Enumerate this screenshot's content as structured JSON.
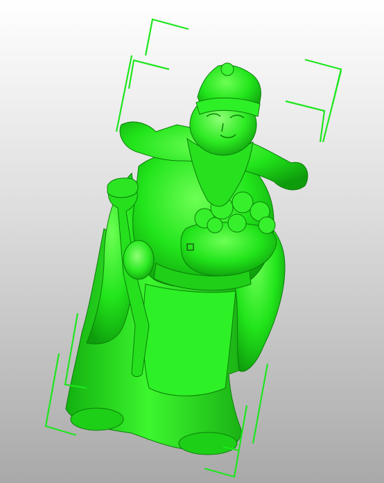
{
  "viewport": {
    "background_top": "#ffffff",
    "background_bottom": "#a9a9a9"
  },
  "model": {
    "name": "statue-model",
    "color": "#22e51b",
    "shade_color": "#0c8f0a",
    "highlight_color": "#9dff8e"
  },
  "bounding_box": {
    "color": "#1ee61e",
    "corner_brackets": 8
  },
  "pivot_marker": {
    "icon": "square-marker-icon",
    "color": "#1a4a1a"
  }
}
